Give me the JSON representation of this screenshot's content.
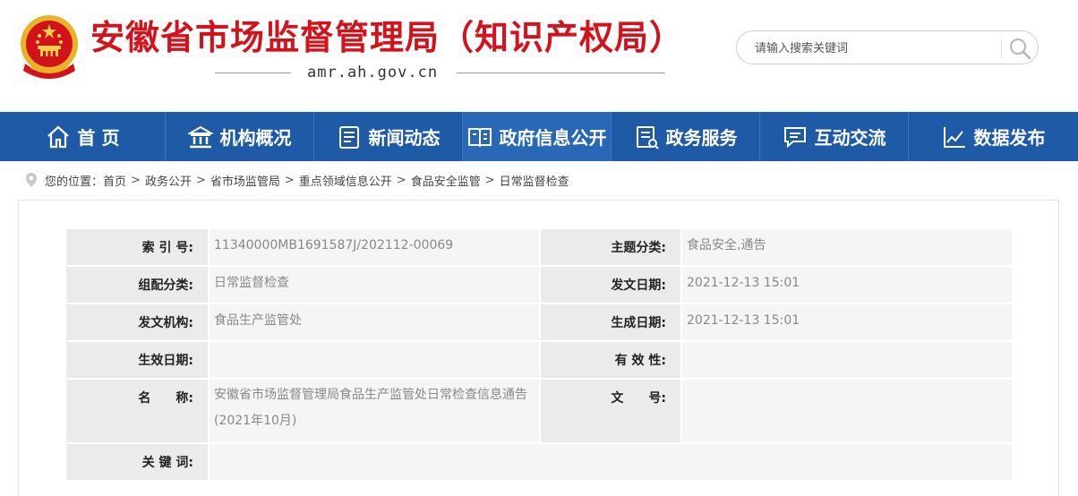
{
  "header": {
    "title": "安徽省市场监督管理局（知识产权局）",
    "domain": "amr.ah.gov.cn",
    "emblem_icon": "national-emblem-icon",
    "title_color": "#d2131b"
  },
  "search": {
    "placeholder": "请输入搜索关键词",
    "button_icon": "search-icon"
  },
  "nav": {
    "color": "#1f5aa7",
    "items": [
      {
        "label": "首 页",
        "icon": "home-icon"
      },
      {
        "label": "机构概况",
        "icon": "building-icon"
      },
      {
        "label": "新闻动态",
        "icon": "news-icon"
      },
      {
        "label": "政府信息公开",
        "icon": "open-book-icon"
      },
      {
        "label": "政务服务",
        "icon": "service-form-icon"
      },
      {
        "label": "互动交流",
        "icon": "chat-icon"
      },
      {
        "label": "数据发布",
        "icon": "line-chart-icon"
      }
    ]
  },
  "breadcrumb": {
    "prefix": "您的位置：",
    "items": [
      "首页",
      "政务公开",
      "省市场监管局",
      "重点领域信息公开",
      "食品安全监管",
      "日常监督检查"
    ],
    "separator": ">"
  },
  "meta": {
    "rows": [
      {
        "l1": "索 引 号:",
        "v1": "11340000MB1691587J/202112-00069",
        "l2": "主题分类:",
        "v2": "食品安全,通告"
      },
      {
        "l1": "组配分类:",
        "v1": "日常监督检查",
        "l2": "发文日期:",
        "v2": "2021-12-13 15:01"
      },
      {
        "l1": "发文机构:",
        "v1": "食品生产监管处",
        "l2": "生成日期:",
        "v2": "2021-12-13 15:01"
      },
      {
        "l1": "生效日期:",
        "v1": "",
        "l2": "有 效 性:",
        "v2": ""
      },
      {
        "l1": "名　　称:",
        "v1": "安徽省市场监督管理局食品生产监管处日常检查信息通告(2021年10月)",
        "l2": "文　　号:",
        "v2": ""
      },
      {
        "l1": "关 键 词:",
        "v1": ""
      }
    ]
  }
}
